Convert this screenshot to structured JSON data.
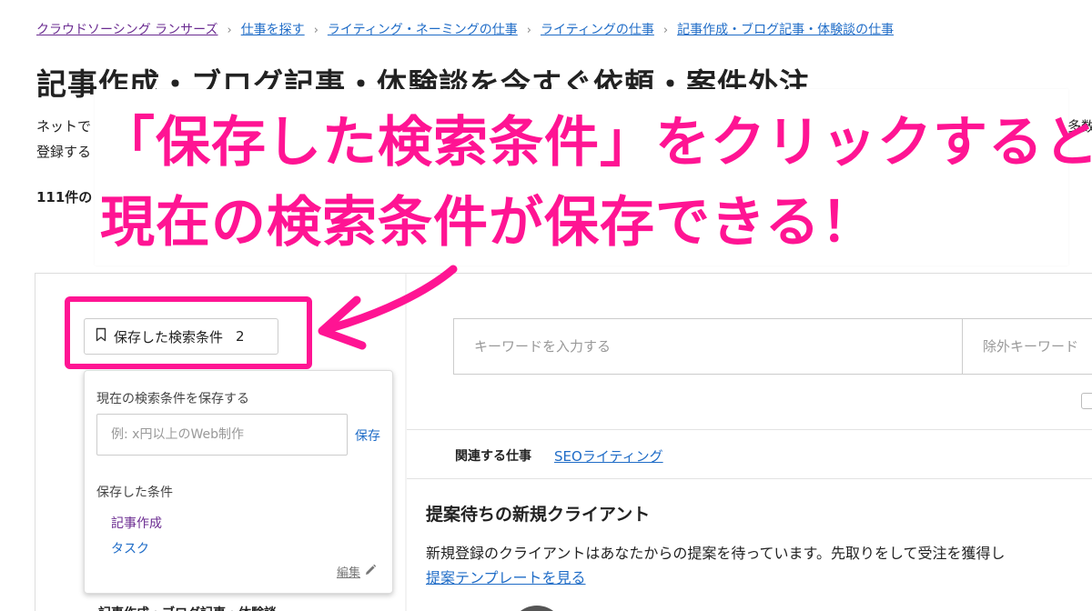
{
  "breadcrumb": [
    {
      "label": "クラウドソーシング ランサーズ"
    },
    {
      "label": "仕事を探す"
    },
    {
      "label": "ライティング・ネーミングの仕事"
    },
    {
      "label": "ライティングの仕事"
    },
    {
      "label": "記事作成・ブログ記事・体験談の仕事"
    }
  ],
  "breadcrumb_separator": "›",
  "page": {
    "title": "記事作成・ブログ記事・体験談を今すぐ依頼・案件外注",
    "desc_line1_visible": "ネットで",
    "desc_line1_right_visible": "多数",
    "desc_line2_visible": "登録する",
    "count_visible": "111件の"
  },
  "sidebar": {
    "saved_search_button": {
      "label": "保存した検索条件",
      "count": "2",
      "icon": "bookmark-icon"
    },
    "dropdown": {
      "save_current_label": "現在の検索条件を保存する",
      "name_input_placeholder": "例: x円以上のWeb制作",
      "save_button": "保存",
      "saved_heading": "保存した条件",
      "saved_items": [
        "記事作成",
        "タスク"
      ],
      "edit_link": "編集",
      "edit_icon": "pencil-icon"
    },
    "bottom_cut_text": "記事作成・ブログ記事・体験談"
  },
  "search": {
    "keyword_placeholder": "キーワードを入力する",
    "exclude_placeholder": "除外キーワード"
  },
  "related": {
    "label": "関連する仕事",
    "link": "SEOライティング"
  },
  "new_clients": {
    "title": "提案待ちの新規クライアント",
    "text": "新規登録のクライアントはあなたからの提案を待っています。先取りをして受注を獲得し",
    "template_link": "提案テンプレートを見る"
  },
  "callout": {
    "line1": "「保存した検索条件」をクリックすると",
    "line2": "現在の検索条件が保存できる！"
  },
  "colors": {
    "accent_pink": "#ff1493",
    "link_blue": "#1f6cc7",
    "visited_purple": "#6b2c91"
  }
}
